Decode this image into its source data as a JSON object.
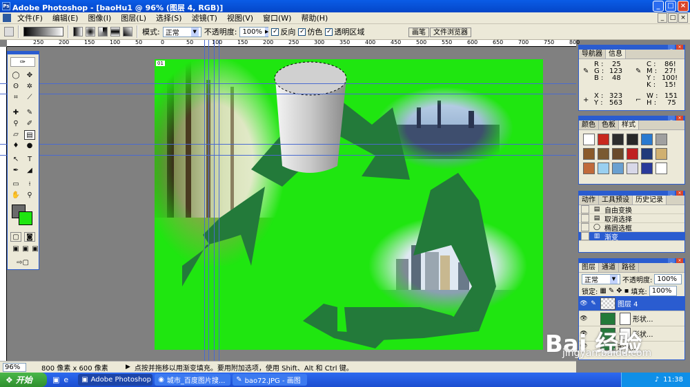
{
  "window": {
    "title": "Adobe Photoshop - [baoHu1 @ 96% (图层 4, RGB)]",
    "min": "_",
    "max": "□",
    "close": "×"
  },
  "menu": {
    "items": [
      "文件(F)",
      "编辑(E)",
      "图像(I)",
      "图层(L)",
      "选择(S)",
      "滤镜(T)",
      "视图(V)",
      "窗口(W)",
      "帮助(H)"
    ]
  },
  "options": {
    "mode_label": "模式:",
    "mode_value": "正常",
    "opacity_label": "不透明度:",
    "opacity_value": "100%",
    "reverse": "反向",
    "dither": "仿色",
    "transparency": "透明区域",
    "tab_brush": "画笔",
    "tab_browser": "文件浏览器"
  },
  "ruler": {
    "top": [
      "250",
      "200",
      "150",
      "100",
      "50",
      "0",
      "50",
      "100",
      "150",
      "200",
      "250",
      "300",
      "350",
      "400",
      "450",
      "500",
      "550",
      "600",
      "650",
      "700",
      "750",
      "800"
    ]
  },
  "canvas": {
    "badge": "01",
    "bg_color": "#1fe610",
    "arrow_color": "#237a3a"
  },
  "status": {
    "zoom": "96%",
    "doc": "800 像素 x 600 像素",
    "hint": "点按并拖移以用渐变填充。要用附加选项，使用 Shift、Alt 和 Ctrl 键。"
  },
  "info_panel": {
    "tabs": [
      "导航器",
      "信息"
    ],
    "R": "25",
    "G": "123",
    "B": "48",
    "C": "86!",
    "M": "27!",
    "Y": "100!",
    "K": "15!",
    "X": "323",
    "Y2": "563",
    "W": "151",
    "H": "75"
  },
  "swatch_panel": {
    "tabs": [
      "颜色",
      "色板",
      "样式"
    ],
    "swatches": [
      "#ffffff",
      "#c8281e",
      "#2d2d2d",
      "#282828",
      "#2a7ad0",
      "#a0a0a0",
      "#8a5a2a",
      "#7a5a32",
      "#6a4a2a",
      "#c02020",
      "#203a7a",
      "#d0b070",
      "#c06a3a",
      "#9ad0f0",
      "#6aa0d0",
      "#d8d8e8",
      "#2a3a9a",
      "#ffffff"
    ]
  },
  "history_panel": {
    "tabs": [
      "动作",
      "工具预设",
      "历史记录"
    ],
    "items": [
      "自由变换",
      "取消选择",
      "椭圆选框",
      "渐变"
    ]
  },
  "layers_panel": {
    "tabs": [
      "图层",
      "通道",
      "路径"
    ],
    "mode": "正常",
    "opacity_label": "不透明度:",
    "opacity": "100%",
    "lock_label": "锁定:",
    "fill_label": "填充:",
    "fill": "100%",
    "layers": [
      "图层 4",
      "形状...",
      "形状...",
      "形状..."
    ]
  },
  "taskbar": {
    "start": "开始",
    "items": [
      "Adobe Photoshop ...",
      "城市_百度图片搜...",
      "bao72.JPG - 画图"
    ],
    "clock": "11:38"
  },
  "watermark": {
    "main": "Bai 经验",
    "sub": "jingyan.baidu.com"
  }
}
